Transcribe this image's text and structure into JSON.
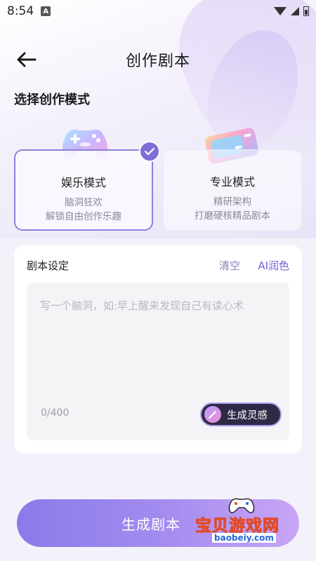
{
  "status_bar": {
    "time": "8:54",
    "notification_letter": "A"
  },
  "header": {
    "title": "创作剧本"
  },
  "mode_section": {
    "title": "选择创作模式"
  },
  "modes": [
    {
      "title": "娱乐模式",
      "desc_line1": "脑洞狂欢",
      "desc_line2": "解锁自由创作乐趣",
      "selected": true
    },
    {
      "title": "专业模式",
      "desc_line1": "精研架构",
      "desc_line2": "打磨硬核精品剧本",
      "selected": false
    }
  ],
  "settings": {
    "title": "剧本设定",
    "clear_label": "清空",
    "ai_polish_label": "AI润色",
    "placeholder": "写一个脑洞，如:早上醒来发现自己有读心术",
    "value": "",
    "char_count": "0/400",
    "inspire_label": "生成灵感"
  },
  "generate_button": {
    "label": "生成剧本"
  },
  "watermark": {
    "text": "宝贝游戏网",
    "url": "baobeiy.com"
  },
  "colors": {
    "accent": "#7d6fd6",
    "ai_polish": "#7460e0",
    "inspire_bg": "#2e2a45",
    "watermark_yellow": "#ffd034"
  }
}
